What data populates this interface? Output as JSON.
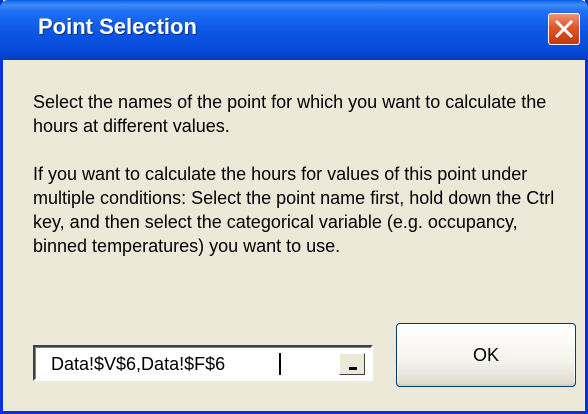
{
  "window": {
    "title": "Point Selection"
  },
  "body": {
    "paragraph1": "Select the names of the point for which you want to calculate the hours at different values.",
    "paragraph2": "If you want to calculate the hours for values of this point under multiple conditions: Select the point name first, hold down the Ctrl key, and then select the categorical variable (e.g. occupancy, binned temperatures) you want to use."
  },
  "ref_edit": {
    "value": "Data!$V$6,Data!$F$6"
  },
  "buttons": {
    "ok_label": "OK"
  },
  "icons": {
    "close": "close-icon",
    "collapse": "collapse-dialog-icon"
  },
  "colors": {
    "titlebar": "#0b56e4",
    "close_button": "#e0552c",
    "dialog_background": "#ece9d8"
  }
}
